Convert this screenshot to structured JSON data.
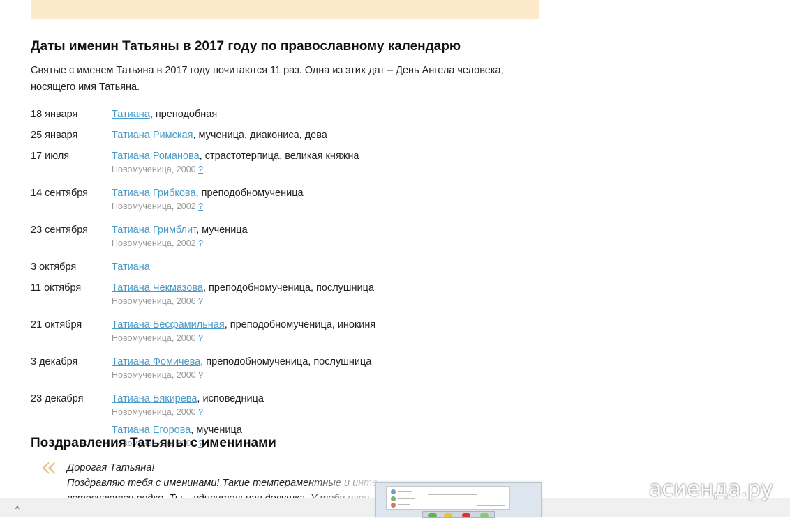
{
  "article": {
    "nameday_title": "Даты именин Татьяны в 2017 году по православному календарю",
    "intro": "Святые с именем Татьяна в 2017 году почитаются 11 раз. Одна из этих дат – День Ангела человека, носящего имя Татьяна.",
    "rows": [
      {
        "date": "18 января",
        "saints": [
          {
            "name": "Татиана",
            "desc": ", преподобная"
          }
        ]
      },
      {
        "date": "25 января",
        "saints": [
          {
            "name": "Татиана Римская",
            "desc": ", мученица, диакониса, дева"
          }
        ]
      },
      {
        "date": "17 июля",
        "saints": [
          {
            "name": "Татиана Романова",
            "desc": ", страстотерпица, великая княжна",
            "note": "Новомученица, 2000",
            "q": "?"
          }
        ]
      },
      {
        "date": "14 сентября",
        "saints": [
          {
            "name": "Татиана Грибкова",
            "desc": ", преподобномученица",
            "note": "Новомученица, 2002",
            "q": "?"
          }
        ]
      },
      {
        "date": "23 сентября",
        "saints": [
          {
            "name": "Татиана Гримблит",
            "desc": ", мученица",
            "note": "Новомученица, 2002",
            "q": "?"
          }
        ]
      },
      {
        "date": "3 октября",
        "saints": [
          {
            "name": "Татиана",
            "desc": ""
          }
        ]
      },
      {
        "date": "11 октября",
        "saints": [
          {
            "name": "Татиана Чекмазова",
            "desc": ", преподобномученица, послушница",
            "note": "Новомученица, 2006",
            "q": "?"
          }
        ]
      },
      {
        "date": "21 октября",
        "saints": [
          {
            "name": "Татиана Бесфамильная",
            "desc": ", преподобномученица, инокиня",
            "note": "Новомученица, 2000",
            "q": "?"
          }
        ]
      },
      {
        "date": "3 декабря",
        "saints": [
          {
            "name": "Татиана Фомичева",
            "desc": ", преподобномученица, послушница",
            "note": "Новомученица, 2000",
            "q": "?"
          }
        ]
      },
      {
        "date": "23 декабря",
        "saints": [
          {
            "name": "Татиана Бякирева",
            "desc": ", исповедница",
            "note": "Новомученица, 2000",
            "q": "?"
          },
          {
            "name": "Татиана Егорова",
            "desc": ", мученица",
            "note": "Новомученица, 2000",
            "q": "?"
          }
        ]
      }
    ],
    "greetings_title": "Поздравления Татьяны с именинами",
    "quote_mark": "«",
    "quote_line1": "Дорогая Татьяна!",
    "quote_line2": "Поздравляю тебя с именинами! Такие темпераментные и инте",
    "quote_line3": "встречаются редко. Ты – удивительная девушка. У тебя огро"
  },
  "taskbar": {
    "chevron": "^"
  },
  "watermark": {
    "text": "асиенда.ру"
  },
  "colors": {
    "link": "#4a9ac9",
    "banner": "#fce9c9",
    "quote_mark": "#e6c38b",
    "note": "#999999"
  }
}
